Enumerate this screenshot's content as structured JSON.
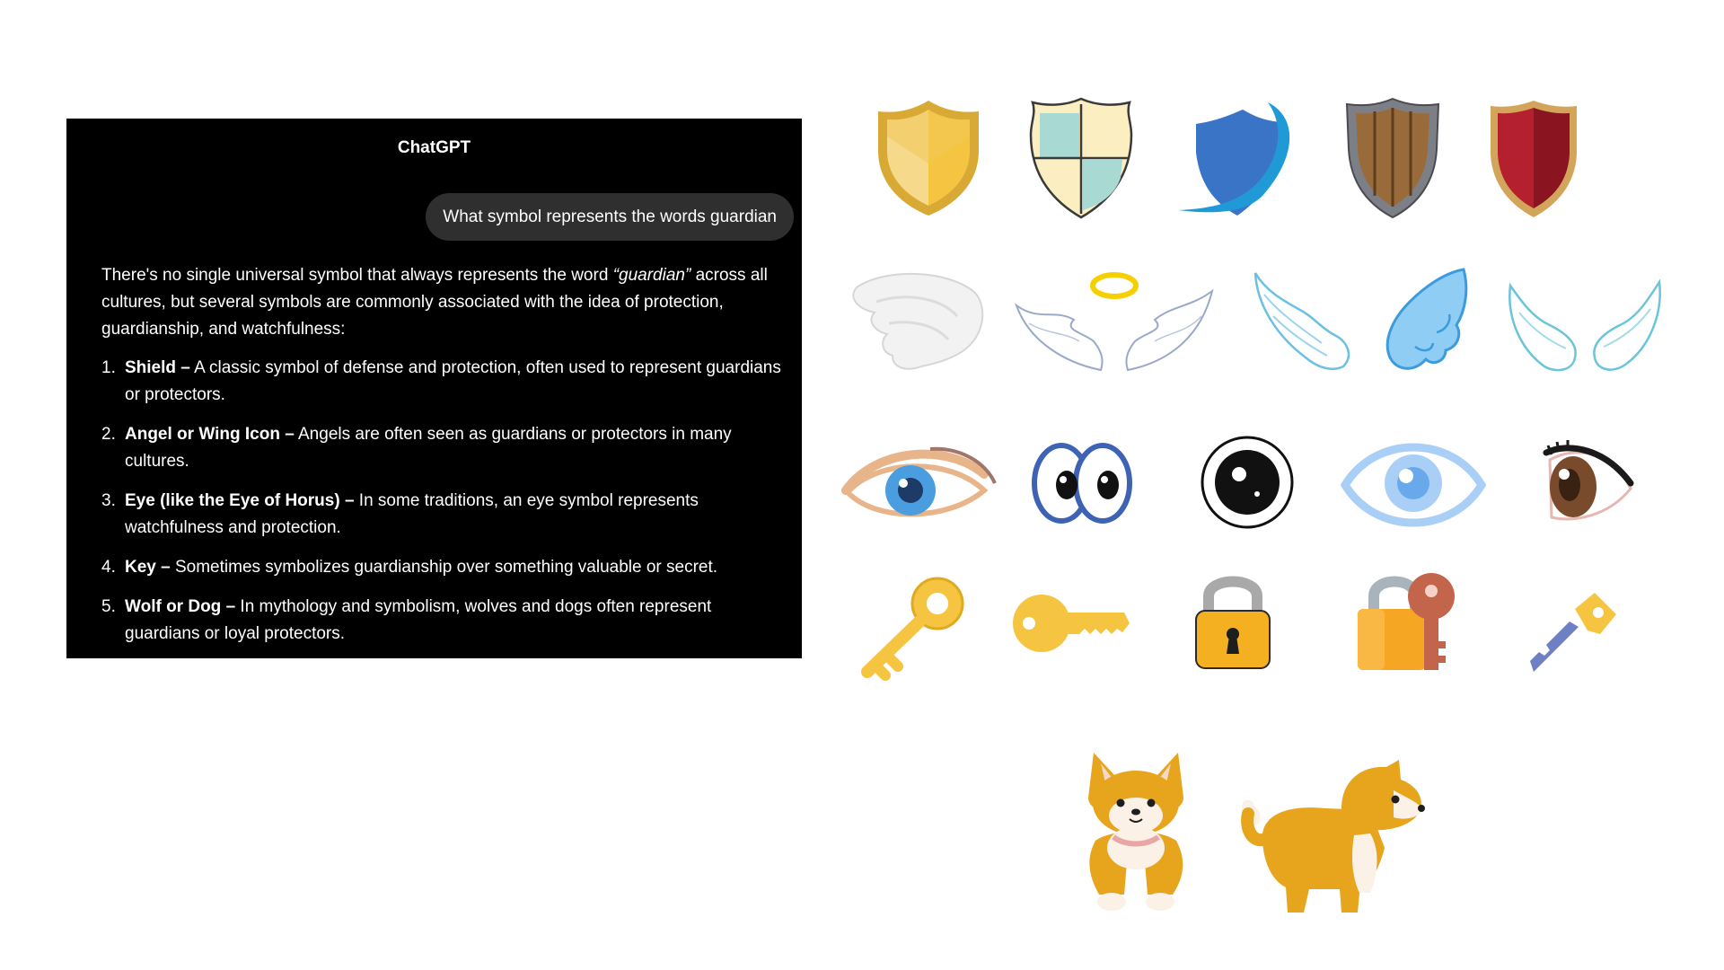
{
  "chat": {
    "title": "ChatGPT",
    "user_message": "What symbol represents the words guardian",
    "intro_before": "There's no single universal symbol that always represents the word ",
    "intro_em": "“guardian”",
    "intro_after": " across all cultures, but several symbols are commonly associated with the idea of protection, guardianship, and watchfulness:",
    "items": [
      {
        "num": "1.",
        "term": "Shield –",
        "desc": " A classic symbol of defense and protection, often used to represent guardians or protectors."
      },
      {
        "num": "2.",
        "term": "Angel or Wing Icon –",
        "desc": " Angels are often seen as guardians or protectors in many cultures."
      },
      {
        "num": "3.",
        "term": "Eye (like the Eye of Horus) –",
        "desc": " In some traditions, an eye symbol represents watchfulness and protection."
      },
      {
        "num": "4.",
        "term": "Key –",
        "desc": " Sometimes symbolizes guardianship over something valuable or secret."
      },
      {
        "num": "5.",
        "term": "Wolf or Dog –",
        "desc": " In mythology and symbolism, wolves and dogs often represent guardians or loyal protectors."
      }
    ]
  },
  "icons": {
    "shields": [
      "gold-shield-icon",
      "quartered-shield-icon",
      "blue-swoosh-shield-icon",
      "wooden-shield-icon",
      "red-shield-icon"
    ],
    "wings": [
      "white-3d-wing-icon",
      "angel-wings-halo-icon",
      "outline-wing-icon",
      "blue-wing-icon",
      "pair-of-wings-icon"
    ],
    "eyes": [
      "blue-eye-icon",
      "cartoon-eyes-icon",
      "black-eye-icon",
      "light-blue-eye-icon",
      "brown-eye-icon"
    ],
    "keys": [
      "yellow-key-icon",
      "flat-key-icon",
      "padlock-icon",
      "padlock-with-key-icon",
      "blue-key-icon"
    ],
    "dogs": [
      "shiba-front-icon",
      "shiba-side-icon"
    ]
  },
  "colors": {
    "panel_bg": "#000000",
    "bubble_bg": "#2f2f2f",
    "gold": "#f5c542",
    "sky_blue": "#9fd8f5",
    "shiba": "#e8a817"
  }
}
